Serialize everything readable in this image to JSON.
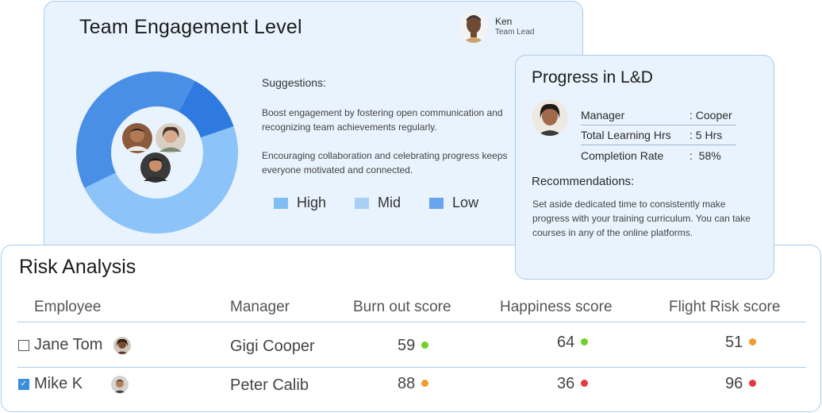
{
  "engagement": {
    "title": "Team Engagement Level",
    "lead": {
      "name": "Ken",
      "role": "Team Lead"
    },
    "suggestions_title": "Suggestions:",
    "suggestion_1": "Boost engagement by fostering open communication and recognizing team achievements regularly.",
    "suggestion_2": "Encouraging collaboration and celebrating progress keeps everyone motivated and connected.",
    "legend": [
      {
        "label": "High",
        "color": "#7fbef4"
      },
      {
        "label": "Mid",
        "color": "#a9cff7"
      },
      {
        "label": "Low",
        "color": "#6aa3ef"
      }
    ],
    "donut_segments": [
      {
        "level": "High",
        "fraction": 0.4,
        "color": "#4a8fe6"
      },
      {
        "level": "Mid",
        "fraction": 0.48,
        "color": "#8cc3f8"
      },
      {
        "level": "Low",
        "fraction": 0.12,
        "color": "#2f7ae0"
      }
    ]
  },
  "progress": {
    "title": "Progress in L&D",
    "rows": [
      {
        "key": "Manager",
        "value": ": Cooper"
      },
      {
        "key": "Total Learning Hrs",
        "value": ": 5 Hrs"
      },
      {
        "key": "Completion Rate",
        "value": ":  58%"
      }
    ],
    "recommendations_title": "Recommendations:",
    "recommendations_text": "Set aside dedicated time to consistently make progress with your training curriculum. You can take courses in any of the online platforms."
  },
  "risk": {
    "title": "Risk Analysis",
    "columns": [
      "Employee",
      "Manager",
      "Burn out score",
      "Happiness score",
      "Flight Risk score"
    ],
    "rows": [
      {
        "checked": false,
        "employee": "Jane Tom",
        "manager": "Gigi Cooper",
        "burnout": "59",
        "burnout_color": "#6fd12a",
        "happiness": "64",
        "happiness_color": "#6fd12a",
        "flight": "51",
        "flight_color": "#f39a2e"
      },
      {
        "checked": true,
        "employee": "Mike K",
        "manager": "Peter Calib",
        "burnout": "88",
        "burnout_color": "#f39a2e",
        "happiness": "36",
        "happiness_color": "#e8383b",
        "flight": "96",
        "flight_color": "#e8383b"
      }
    ]
  }
}
